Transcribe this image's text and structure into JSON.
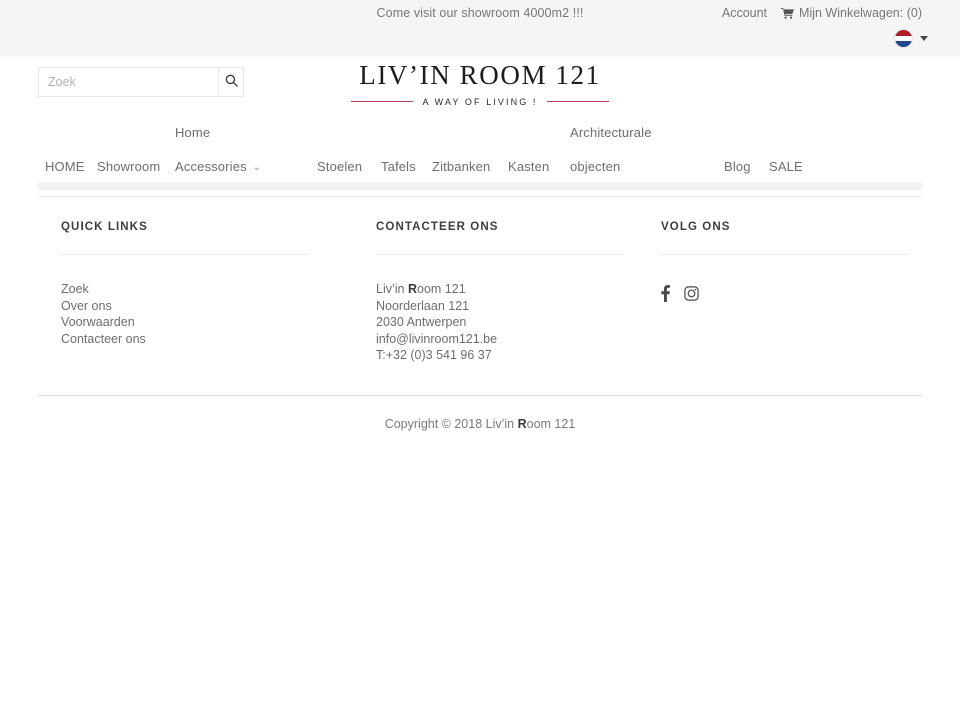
{
  "topbar": {
    "message": "Come visit our showroom  4000m2 !!!",
    "account_label": "Account",
    "cart_label": "Mijn Winkelwagen: (0)",
    "cart_icon": "shopping-cart-icon",
    "language_flag": "netherlands-flag-icon",
    "language_caret": "chevron-down-icon",
    "flag_colors": [
      "#ae1c28",
      "#ffffff",
      "#21468b"
    ]
  },
  "header": {
    "search_placeholder": "Zoek",
    "search_value": "",
    "search_icon": "search-icon",
    "logo_title": "LIV’IN ROOM 121",
    "logo_tagline": "A WAY OF LIVING !",
    "logo_rule_color": "#b5434f"
  },
  "nav": {
    "dropdown_label_1": "Home",
    "dropdown_label_2": "Architecturale",
    "items": [
      {
        "label": "HOME",
        "caret": false
      },
      {
        "label": "Showroom",
        "caret": false
      },
      {
        "label": "Accessories",
        "caret": true
      },
      {
        "label": "Stoelen",
        "caret": false
      },
      {
        "label": "Tafels",
        "caret": false
      },
      {
        "label": "Zitbanken",
        "caret": false
      },
      {
        "label": "Kasten",
        "caret": false
      },
      {
        "label": "objecten",
        "caret": false
      },
      {
        "label": "Blog",
        "caret": false
      },
      {
        "label": "SALE",
        "caret": false
      }
    ],
    "caret_glyph": "⌄"
  },
  "footer": {
    "quick_links": {
      "heading": "QUICK LINKS",
      "items": [
        "Zoek",
        "Over ons",
        "Voorwaarden",
        "Contacteer ons"
      ]
    },
    "contact": {
      "heading": "CONTACTEER ONS",
      "company_prefix": "Liv’in ",
      "company_cap": "R",
      "company_suffix": "oom 121",
      "street": "Noorderlaan 121",
      "city": "2030 Antwerpen",
      "email": "info@livinroom121.be",
      "phone": "T:+32 (0)3 541 96 37"
    },
    "follow": {
      "heading": "VOLG ONS",
      "social": [
        {
          "name": "facebook-icon"
        },
        {
          "name": "instagram-icon"
        }
      ]
    },
    "copyright_prefix": "Copyright © 2018 Liv’in ",
    "copyright_cap": "R",
    "copyright_suffix": "oom 121"
  }
}
